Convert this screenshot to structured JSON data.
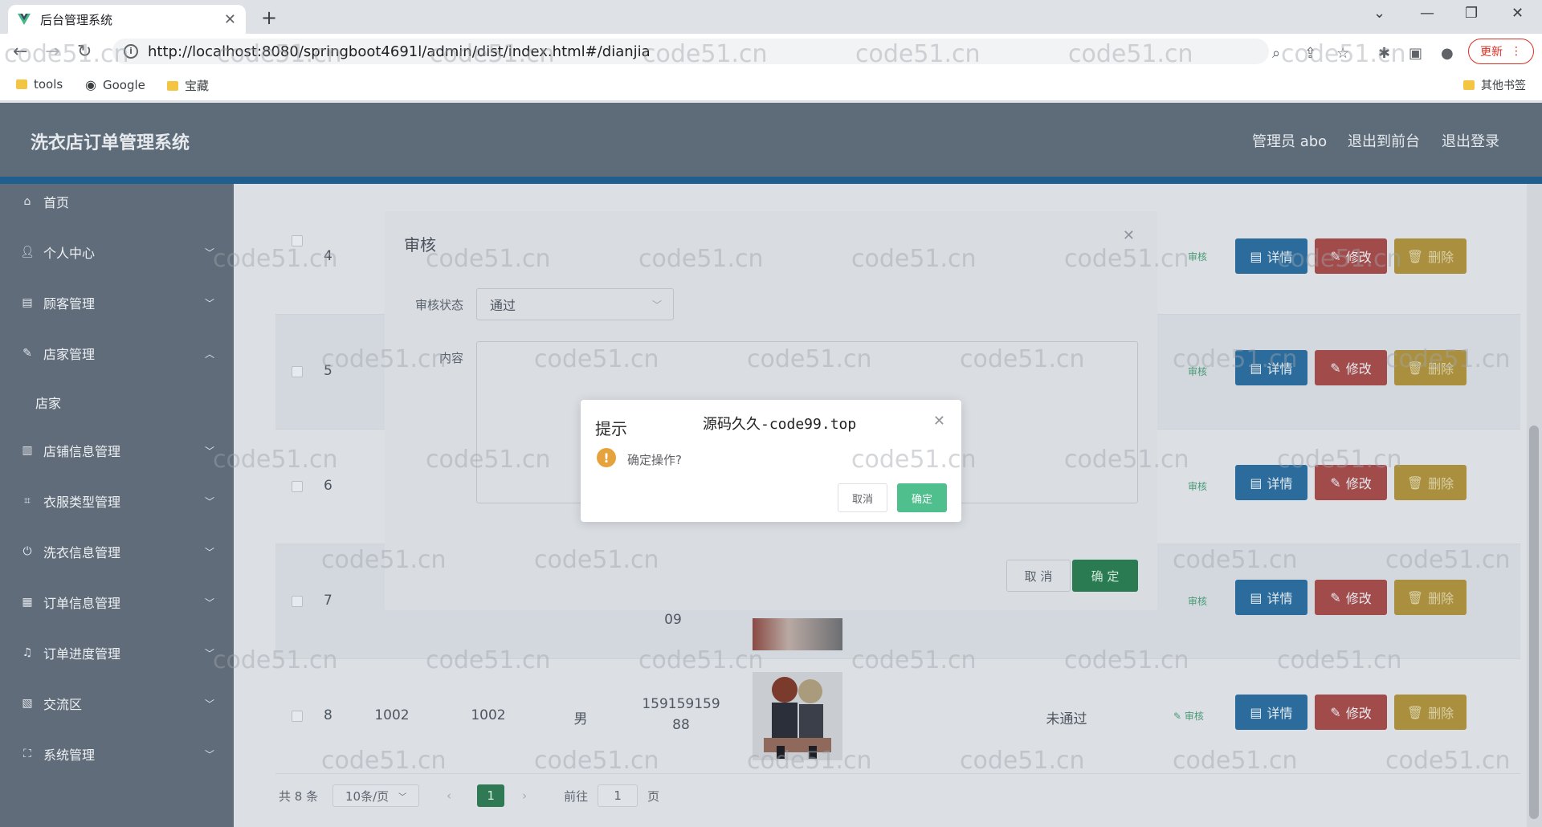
{
  "browser": {
    "tab_title": "后台管理系统",
    "url": "http://localhost:8080/springboot4691l/admin/dist/index.html#/dianjia",
    "update_label": "更新",
    "bookmarks": [
      "tools",
      "Google",
      "宝藏"
    ],
    "other_bookmarks": "其他书签"
  },
  "header": {
    "brand": "洗衣店订单管理系统",
    "user": "管理员 abo",
    "to_front": "退出到前台",
    "logout": "退出登录"
  },
  "sidebar": {
    "items": [
      {
        "label": "首页",
        "icon": "home-icon"
      },
      {
        "label": "个人中心",
        "icon": "user-icon"
      },
      {
        "label": "顾客管理",
        "icon": "briefcase-icon"
      },
      {
        "label": "店家管理",
        "icon": "edit-icon"
      },
      {
        "label": "店铺信息管理",
        "icon": "chart-icon"
      },
      {
        "label": "衣服类型管理",
        "icon": "crop-icon"
      },
      {
        "label": "洗衣信息管理",
        "icon": "power-icon"
      },
      {
        "label": "订单信息管理",
        "icon": "grid-icon"
      },
      {
        "label": "订单进度管理",
        "icon": "mic-icon"
      },
      {
        "label": "交流区",
        "icon": "film-icon"
      },
      {
        "label": "系统管理",
        "icon": "frame-icon"
      }
    ],
    "sub_item": "店家"
  },
  "table": {
    "rows": [
      {
        "index": "4",
        "status": "",
        "audit": "审核"
      },
      {
        "index": "5",
        "status": "",
        "audit": "审核"
      },
      {
        "index": "6",
        "status": "",
        "audit": "审核"
      },
      {
        "index": "7",
        "status": "",
        "audit": "审核",
        "phone_partial": "09"
      },
      {
        "index": "8",
        "account": "1002",
        "name": "1002",
        "gender": "男",
        "phone": "15915915988",
        "phone_line1": "159159159",
        "phone_line2": "88",
        "status": "未通过",
        "audit": "审核"
      }
    ],
    "detail_label": "详情",
    "edit_label": "修改",
    "delete_label": "删除"
  },
  "pagination": {
    "total": "共 8 条",
    "page_size": "10条/页",
    "current": "1",
    "goto_label": "前往",
    "goto_value": "1",
    "page_unit": "页"
  },
  "audit_dialog": {
    "title": "审核",
    "status_label": "审核状态",
    "status_value": "通过",
    "content_label": "内容",
    "cancel": "取 消",
    "ok": "确 定"
  },
  "confirm_dialog": {
    "title": "提示",
    "subtitle": "源码久久-code99.top",
    "message": "确定操作?",
    "cancel": "取消",
    "ok": "确定"
  },
  "watermark": "code51.cn",
  "colors": {
    "header_bg": "#5e6b78",
    "accent_green": "#4fc08d",
    "warn": "#e6a23c"
  }
}
